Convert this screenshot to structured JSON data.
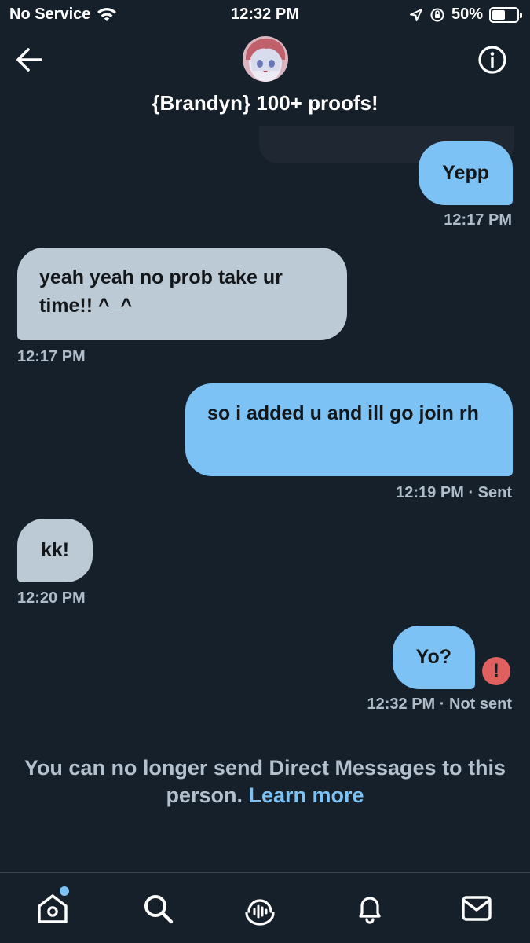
{
  "status_bar": {
    "carrier": "No Service",
    "time": "12:32 PM",
    "battery_percent": "50%",
    "battery_level": 0.5
  },
  "header": {
    "title": "{Brandyn} 100+ proofs!",
    "back_icon": "arrow-left-icon",
    "info_icon": "info-circle-icon"
  },
  "messages": [
    {
      "direction": "out",
      "text": "Yepp",
      "time": "12:17 PM",
      "status": ""
    },
    {
      "direction": "in",
      "text": "yeah yeah no prob take ur time!! ^_^",
      "time": "12:17 PM",
      "status": ""
    },
    {
      "direction": "out",
      "text": "so i added u and ill go join rh",
      "time": "12:19 PM",
      "status": "· Sent"
    },
    {
      "direction": "in",
      "text": "kk!",
      "time": "12:20 PM",
      "status": ""
    },
    {
      "direction": "out",
      "text": "Yo?",
      "time": "12:32 PM",
      "status": "· Not sent"
    }
  ],
  "notice": {
    "text": "You can no longer send Direct Messages to this person.",
    "link": "Learn more"
  },
  "nav": {
    "items": [
      "home-icon",
      "search-icon",
      "spaces-icon",
      "notifications-icon",
      "messages-icon"
    ]
  },
  "colors": {
    "background": "#15202b",
    "outgoing_bubble": "#7dc2f5",
    "incoming_bubble": "#bccad6",
    "error": "#e0605f"
  }
}
